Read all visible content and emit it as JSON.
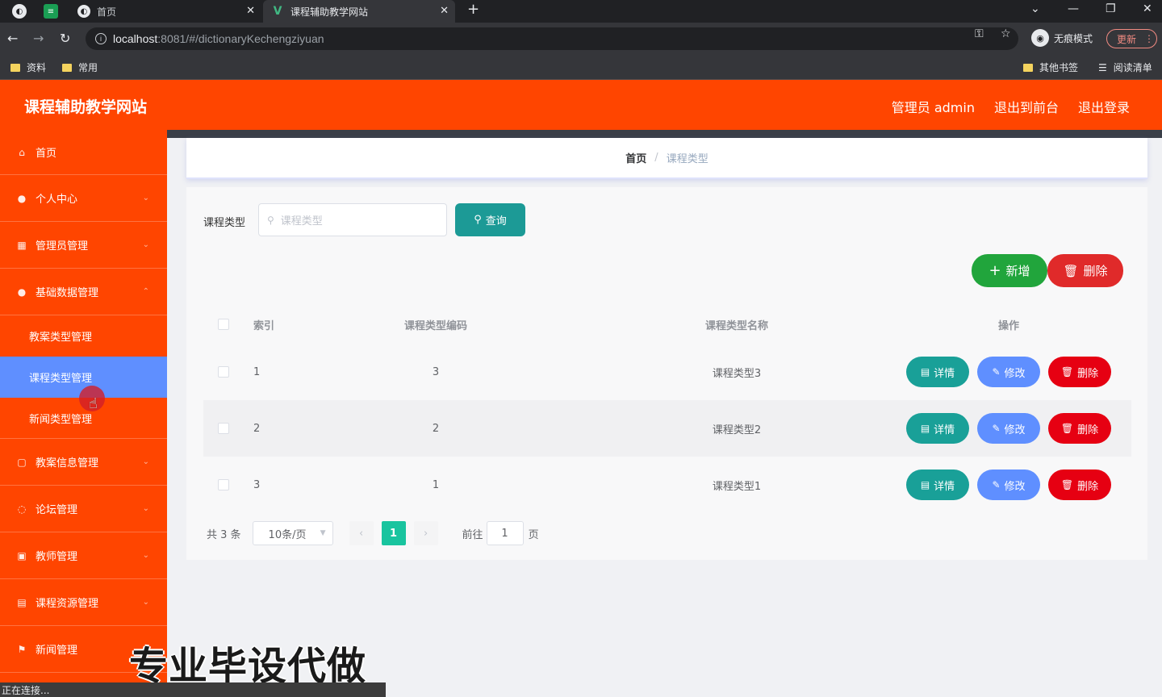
{
  "browser": {
    "tabs": [
      {
        "title": "首页"
      },
      {
        "title": "课程辅助教学网站"
      }
    ],
    "url_host": "localhost",
    "url_path": ":8081/#/dictionaryKechengziyuan",
    "incognito_label": "无痕模式",
    "update_label": "更新",
    "bookmarks": [
      "资料",
      "常用"
    ],
    "other_bookmarks": "其他书签",
    "reading_list": "阅读清单"
  },
  "header": {
    "title": "课程辅助教学网站",
    "user": "管理员 admin",
    "back_front": "退出到前台",
    "logout": "退出登录"
  },
  "sidebar": {
    "items": [
      {
        "label": "首页"
      },
      {
        "label": "个人中心"
      },
      {
        "label": "管理员管理"
      },
      {
        "label": "基础数据管理"
      }
    ],
    "submenu": [
      {
        "label": "教案类型管理"
      },
      {
        "label": "课程类型管理"
      },
      {
        "label": "新闻类型管理"
      }
    ],
    "items_after": [
      {
        "label": "教案信息管理"
      },
      {
        "label": "论坛管理"
      },
      {
        "label": "教师管理"
      },
      {
        "label": "课程资源管理"
      },
      {
        "label": "新闻管理"
      }
    ]
  },
  "breadcrumb": {
    "home": "首页",
    "current": "课程类型"
  },
  "search": {
    "label": "课程类型",
    "placeholder": "课程类型",
    "button": "查询"
  },
  "actions": {
    "add": "新增",
    "delete": "删除"
  },
  "table": {
    "columns": [
      "索引",
      "课程类型编码",
      "课程类型名称",
      "操作"
    ],
    "rows": [
      {
        "index": "1",
        "code": "3",
        "name": "课程类型3"
      },
      {
        "index": "2",
        "code": "2",
        "name": "课程类型2"
      },
      {
        "index": "3",
        "code": "1",
        "name": "课程类型1"
      }
    ],
    "op_detail": "详情",
    "op_edit": "修改",
    "op_delete": "删除"
  },
  "pagination": {
    "total": "共 3 条",
    "page_size": "10条/页",
    "current_page": "1",
    "goto_label": "前往",
    "goto_value": "1",
    "page_suffix": "页"
  },
  "watermark": "专业毕设代做",
  "status": "正在连接..."
}
